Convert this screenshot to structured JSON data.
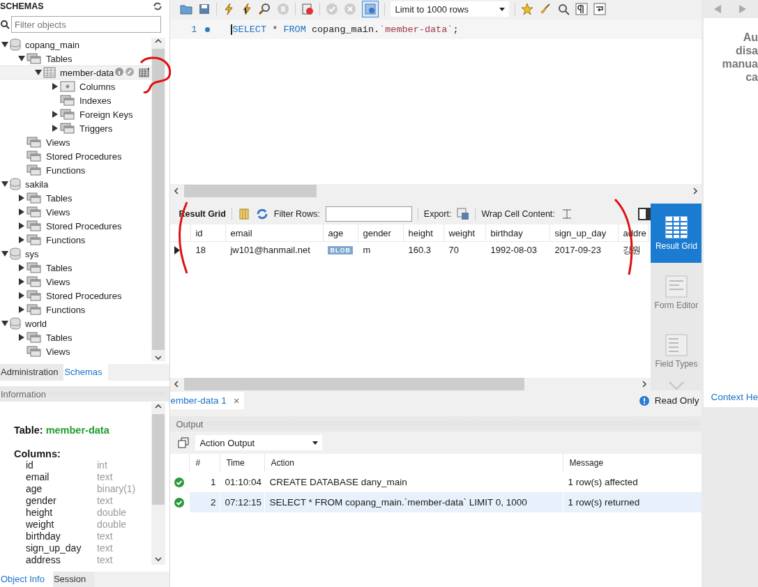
{
  "sidebar": {
    "title": "SCHEMAS",
    "filter": {
      "placeholder": "Filter objects"
    },
    "tree": [
      {
        "label": "copang_main",
        "kind": "schema",
        "expandable": true,
        "expanded": true,
        "selected": false,
        "children": [
          {
            "label": "Tables",
            "kind": "folder",
            "expandable": true,
            "expanded": true,
            "selected": false,
            "children": [
              {
                "label": "member-data",
                "kind": "table",
                "expandable": true,
                "expanded": true,
                "selected": true,
                "children": [
                  {
                    "label": "Columns",
                    "kind": "columns",
                    "expandable": true,
                    "expanded": false,
                    "selected": false
                  },
                  {
                    "label": "Indexes",
                    "kind": "folder",
                    "expandable": false,
                    "expanded": false,
                    "selected": false
                  },
                  {
                    "label": "Foreign Keys",
                    "kind": "folder",
                    "expandable": true,
                    "expanded": false,
                    "selected": false
                  },
                  {
                    "label": "Triggers",
                    "kind": "folder",
                    "expandable": true,
                    "expanded": false,
                    "selected": false
                  }
                ]
              }
            ]
          },
          {
            "label": "Views",
            "kind": "folder",
            "expandable": false,
            "expanded": false,
            "selected": false
          },
          {
            "label": "Stored Procedures",
            "kind": "folder",
            "expandable": false,
            "expanded": false,
            "selected": false
          },
          {
            "label": "Functions",
            "kind": "folder",
            "expandable": false,
            "expanded": false,
            "selected": false
          }
        ]
      },
      {
        "label": "sakila",
        "kind": "schema",
        "expandable": true,
        "expanded": true,
        "selected": false,
        "children": [
          {
            "label": "Tables",
            "kind": "folder",
            "expandable": true,
            "expanded": false,
            "selected": false
          },
          {
            "label": "Views",
            "kind": "folder",
            "expandable": true,
            "expanded": false,
            "selected": false
          },
          {
            "label": "Stored Procedures",
            "kind": "folder",
            "expandable": true,
            "expanded": false,
            "selected": false
          },
          {
            "label": "Functions",
            "kind": "folder",
            "expandable": true,
            "expanded": false,
            "selected": false
          }
        ]
      },
      {
        "label": "sys",
        "kind": "schema",
        "expandable": true,
        "expanded": true,
        "selected": false,
        "children": [
          {
            "label": "Tables",
            "kind": "folder",
            "expandable": true,
            "expanded": false,
            "selected": false
          },
          {
            "label": "Views",
            "kind": "folder",
            "expandable": true,
            "expanded": false,
            "selected": false
          },
          {
            "label": "Stored Procedures",
            "kind": "folder",
            "expandable": true,
            "expanded": false,
            "selected": false
          },
          {
            "label": "Functions",
            "kind": "folder",
            "expandable": true,
            "expanded": false,
            "selected": false
          }
        ]
      },
      {
        "label": "world",
        "kind": "schema",
        "expandable": true,
        "expanded": true,
        "selected": false,
        "children": [
          {
            "label": "Tables",
            "kind": "folder",
            "expandable": true,
            "expanded": false,
            "selected": false
          },
          {
            "label": "Views",
            "kind": "folder",
            "expandable": false,
            "expanded": false,
            "selected": false
          }
        ]
      }
    ],
    "tabs": [
      {
        "label": "Administration",
        "selected": false
      },
      {
        "label": "Schemas",
        "selected": true
      }
    ]
  },
  "information": {
    "title": "Information",
    "table_label": "Table:",
    "table_name": "member-data",
    "columns_label": "Columns:",
    "columns": [
      {
        "name": "id",
        "type": "int"
      },
      {
        "name": "email",
        "type": "text"
      },
      {
        "name": "age",
        "type": "binary(1)"
      },
      {
        "name": "gender",
        "type": "text"
      },
      {
        "name": "height",
        "type": "double"
      },
      {
        "name": "weight",
        "type": "double"
      },
      {
        "name": "birthday",
        "type": "text"
      },
      {
        "name": "sign_up_day",
        "type": "text"
      },
      {
        "name": "address",
        "type": "text"
      }
    ],
    "tabs": [
      {
        "label": "Object Info",
        "selected": true
      },
      {
        "label": "Session",
        "selected": false
      }
    ]
  },
  "toolbar": {
    "autocommit_selected": true,
    "limit": "Limit to 1000 rows"
  },
  "editor": {
    "line": "1",
    "tokens": [
      {
        "text": "SELECT",
        "kind": "keyword"
      },
      {
        "text": " * ",
        "kind": "plain"
      },
      {
        "text": "FROM",
        "kind": "keyword"
      },
      {
        "text": " copang_main.",
        "kind": "plain"
      },
      {
        "text": "`member-data`",
        "kind": "string"
      },
      {
        "text": ";",
        "kind": "plain"
      }
    ]
  },
  "result": {
    "title": "Result Grid",
    "filter_label": "Filter Rows:",
    "export_label": "Export:",
    "wrap_label": "Wrap Cell Content:",
    "columns": [
      "id",
      "email",
      "age",
      "gender",
      "height",
      "weight",
      "birthday",
      "sign_up_day",
      "addre"
    ],
    "rows": [
      {
        "cells": [
          {
            "text": "18",
            "kind": "text"
          },
          {
            "text": "jw101@hanmail.net",
            "kind": "text"
          },
          {
            "text": "BLOB",
            "kind": "blob"
          },
          {
            "text": "m",
            "kind": "text"
          },
          {
            "text": "160.3",
            "kind": "text"
          },
          {
            "text": "70",
            "kind": "text"
          },
          {
            "text": "1992-08-03",
            "kind": "text"
          },
          {
            "text": "2017-09-23",
            "kind": "text"
          },
          {
            "text": "강원",
            "kind": "text"
          }
        ]
      }
    ],
    "side_tabs": [
      {
        "label": "Result Grid",
        "kind": "grid",
        "selected": true
      },
      {
        "label": "Form Editor",
        "kind": "form",
        "selected": false
      },
      {
        "label": "Field Types",
        "kind": "fields",
        "selected": false
      }
    ]
  },
  "query_tab": {
    "label": "ember-data 1",
    "close": "×"
  },
  "status": "Read Only",
  "context_panel": {
    "lines": [
      "Au",
      "disa",
      "manua",
      "ca"
    ],
    "tab": "Context He"
  },
  "output": {
    "title": "Output",
    "select": "Action Output",
    "columns": [
      "#",
      "Time",
      "Action",
      "Message"
    ],
    "rows": [
      {
        "num": "1",
        "time": "01:10:04",
        "action": "CREATE DATABASE dany_main",
        "message": "1 row(s) affected",
        "selected": false
      },
      {
        "num": "2",
        "time": "07:12:15",
        "action": "SELECT * FROM copang_main.`member-data` LIMIT 0, 1000",
        "message": "1 row(s) returned",
        "selected": true
      }
    ]
  }
}
